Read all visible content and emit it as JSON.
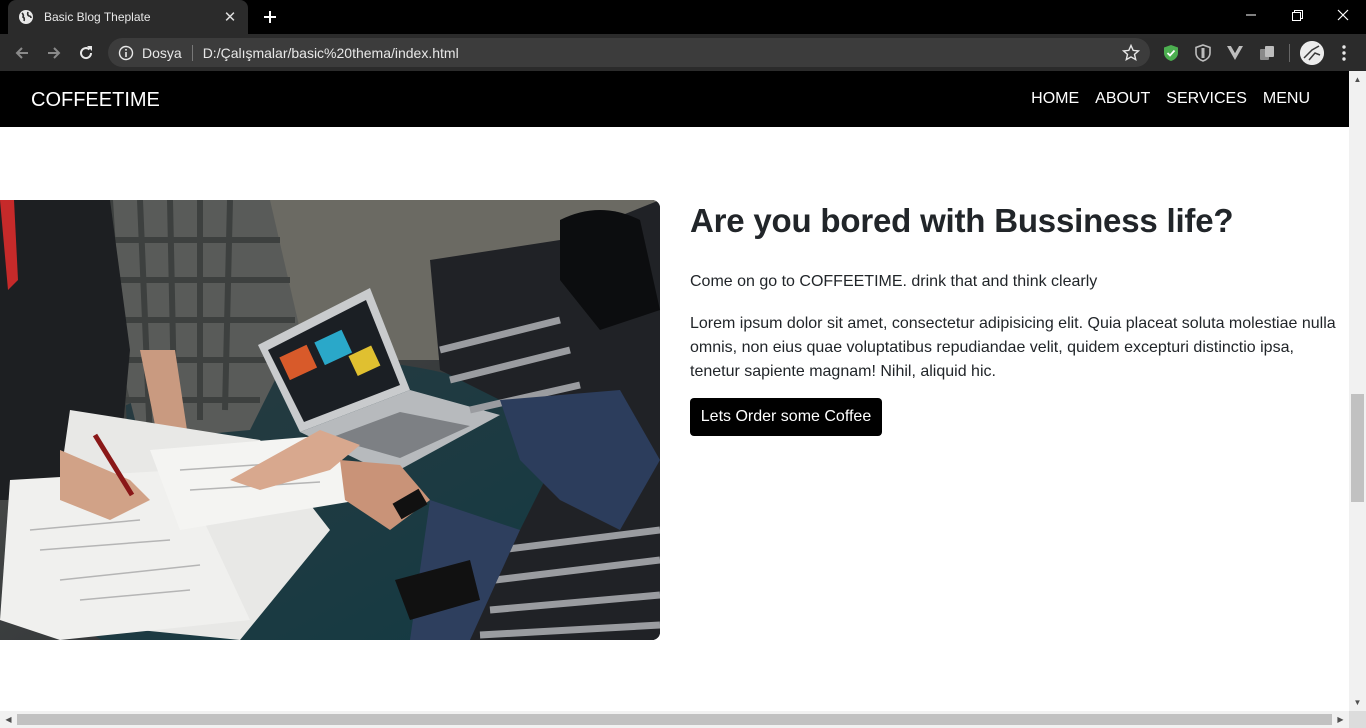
{
  "browser": {
    "tab_title": "Basic Blog Theplate",
    "address_label": "Dosya",
    "url": "D:/Çalışmalar/basic%20thema/index.html",
    "icons": [
      "globe-icon",
      "close-icon",
      "plus-icon",
      "back-icon",
      "forward-icon",
      "reload-icon",
      "info-icon",
      "star-icon",
      "adblock-shield-icon",
      "privacy-shield-icon",
      "vue-devtools-icon",
      "extension-icon",
      "profile-avatar",
      "kebab-menu-icon",
      "minimize-icon",
      "restore-icon",
      "window-close-icon"
    ]
  },
  "site": {
    "brand": "COFFEETIME",
    "nav": [
      "HOME",
      "ABOUT",
      "SERVICES",
      "MENU"
    ],
    "heading": "Are you bored with Bussiness life?",
    "lead": "Come on go to COFFEETIME. drink that and think clearly",
    "body": "Lorem ipsum dolor sit amet, consectetur adipisicing elit. Quia placeat soluta molestiae nulla omnis, non eius quae voluptatibus repudiandae velit, quidem excepturi distinctio ipsa, tenetur sapiente magnam! Nihil, aliquid hic.",
    "cta": "Lets Order some Coffee"
  },
  "colors": {
    "nav_bg": "#000000",
    "button_bg": "#000000",
    "text": "#212529",
    "chrome_bg": "#2b2b2b"
  }
}
